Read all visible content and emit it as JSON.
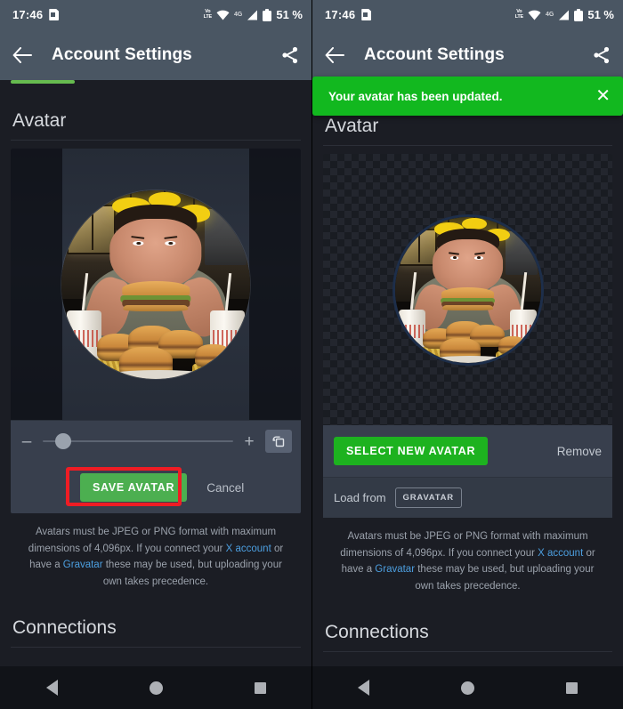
{
  "status_bar": {
    "time": "17:46",
    "sim_icon": "sim-card-icon",
    "volte_label": "VoLTE",
    "wifi_icon": "wifi-icon",
    "network_label": "4G",
    "signal_icon": "signal-bars-icon",
    "battery_icon": "battery-icon",
    "battery_percent": "51 %"
  },
  "app_bar": {
    "back_icon": "back-arrow-icon",
    "title": "Account Settings",
    "share_icon": "share-icon"
  },
  "toast": {
    "message": "Your avatar has been updated.",
    "close_icon": "close-icon",
    "background": "#12b81f"
  },
  "sections": {
    "avatar_heading": "Avatar",
    "connections_heading": "Connections"
  },
  "cropper": {
    "zoom_out_label": "–",
    "zoom_in_label": "+",
    "rotate_icon": "rotate-crop-icon",
    "save_label": "SAVE AVATAR",
    "cancel_label": "Cancel",
    "highlight_color": "#ef1c24",
    "button_color": "#4caf50"
  },
  "avatar_panel": {
    "select_label": "SELECT NEW AVATAR",
    "remove_label": "Remove",
    "load_from_label": "Load from",
    "gravatar_label": "GRAVATAR",
    "button_color": "#1db21f"
  },
  "helper_text": {
    "part1": "Avatars must be JPEG or PNG format with maximum dimensions of 4,096px. If you connect your ",
    "link1": "X account",
    "part2": " or have a ",
    "link2": "Gravatar",
    "part3": " these may be used, but uploading your own takes precedence.",
    "link_color": "#4c9fe0"
  },
  "nav_bar": {
    "back_icon": "nav-back-icon",
    "home_icon": "nav-home-icon",
    "recents_icon": "nav-recents-icon"
  }
}
